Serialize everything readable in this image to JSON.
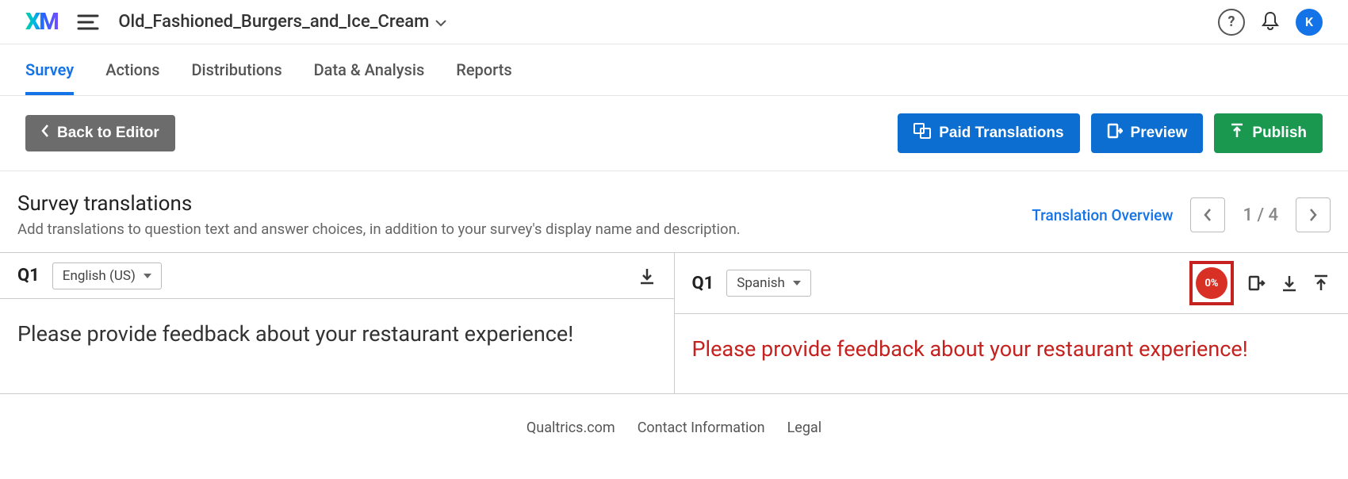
{
  "topbar": {
    "logo_text": "XM",
    "project_name": "Old_Fashioned_Burgers_and_Ice_Cream",
    "avatar_initial": "K"
  },
  "navtabs": {
    "items": [
      {
        "label": "Survey",
        "active": true
      },
      {
        "label": "Actions",
        "active": false
      },
      {
        "label": "Distributions",
        "active": false
      },
      {
        "label": "Data & Analysis",
        "active": false
      },
      {
        "label": "Reports",
        "active": false
      }
    ]
  },
  "actionbar": {
    "back_label": "Back to Editor",
    "paid_label": "Paid Translations",
    "preview_label": "Preview",
    "publish_label": "Publish"
  },
  "section": {
    "title": "Survey translations",
    "subtitle": "Add translations to question text and answer choices, in addition to your survey's display name and description.",
    "overview_link": "Translation Overview",
    "page_indicator": "1 / 4"
  },
  "translation": {
    "left": {
      "q_label": "Q1",
      "language": "English (US)",
      "text": "Please provide feedback about your restaurant experience!"
    },
    "right": {
      "q_label": "Q1",
      "language": "Spanish",
      "progress": "0%",
      "text": "Please provide feedback about your restaurant experience!"
    }
  },
  "footer": {
    "links": [
      "Qualtrics.com",
      "Contact Information",
      "Legal"
    ]
  }
}
